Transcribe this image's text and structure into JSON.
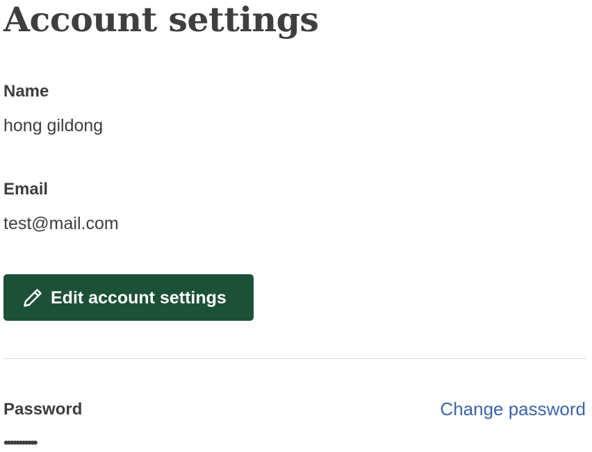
{
  "page": {
    "title": "Account settings"
  },
  "profile": {
    "name_label": "Name",
    "name_value": "hong gildong",
    "email_label": "Email",
    "email_value": "test@mail.com"
  },
  "actions": {
    "edit_label": "Edit account settings",
    "edit_icon": "pencil-icon"
  },
  "password": {
    "label": "Password",
    "value": "•••••••••••",
    "change_link": "Change password"
  },
  "colors": {
    "button_bg": "#1c5138",
    "button_text": "#ffffff",
    "link": "#3a64a8",
    "text": "#3d3d3d",
    "divider": "#d8d8d8"
  }
}
